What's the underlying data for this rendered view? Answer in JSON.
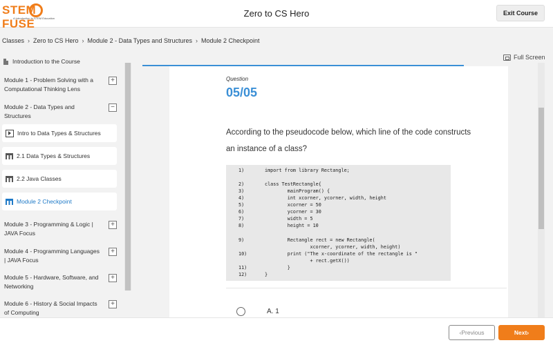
{
  "header": {
    "logo_text_left": "STEM",
    "logo_text_right": "FUSE",
    "logo_tagline": "A Introduction to STEM Education",
    "course_title": "Zero to CS Hero",
    "exit_label": "Exit Course"
  },
  "breadcrumb": [
    "Classes",
    "Zero to CS Hero",
    "Module 2 - Data Types and Structures",
    "Module 2 Checkpoint"
  ],
  "fullscreen_label": "Full Screen",
  "sidebar": {
    "intro": "Introduction to the Course",
    "modules": [
      {
        "label": "Module 1 - Problem Solving with a Computational Thinking Lens",
        "toggle": "+"
      },
      {
        "label": "Module 2 - Data Types and Structures",
        "toggle": "−"
      },
      {
        "label": "Module 3 - Programming & Logic | JAVA Focus",
        "toggle": "+"
      },
      {
        "label": "Module 4 - Programming Languages | JAVA Focus",
        "toggle": "+"
      },
      {
        "label": "Module 5 - Hardware, Software, and Networking",
        "toggle": "+"
      },
      {
        "label": "Module 6 - History & Social Impacts of Computing",
        "toggle": "+"
      }
    ],
    "lessons": [
      {
        "label": "Intro to Data Types & Structures",
        "icon": "play-icon",
        "active": false
      },
      {
        "label": "2.1 Data Types & Structures",
        "icon": "table-icon",
        "active": false
      },
      {
        "label": "2.2 Java Classes",
        "icon": "table-icon",
        "active": false
      },
      {
        "label": "Module 2 Checkpoint",
        "icon": "table-icon",
        "active": true
      }
    ]
  },
  "question": {
    "label": "Question",
    "number": "05/05",
    "text": "According to the pseudocode below, which line of the code constructs an instance of a class?",
    "code": [
      {
        "n": "1)",
        "t": "import from library Rectangle;"
      },
      {
        "n": "2)",
        "t": "class TestRectangle{"
      },
      {
        "n": "3)",
        "t": "        mainProgram() {"
      },
      {
        "n": "4)",
        "t": "        int xcorner, ycorner, width, height"
      },
      {
        "n": "5)",
        "t": "        xcorner = 50"
      },
      {
        "n": "6)",
        "t": "        ycorner = 30"
      },
      {
        "n": "7)",
        "t": "        width = 5"
      },
      {
        "n": "8)",
        "t": "        height = 10"
      },
      {
        "n": "9)",
        "t": "        Rectangle rect = new Rectangle("
      },
      {
        "n": "",
        "t": "                xcorner, ycorner, width, height)"
      },
      {
        "n": "10)",
        "t": "        print (\"The x-coordinate of the rectangle is \""
      },
      {
        "n": "",
        "t": "                + rect.getX())"
      },
      {
        "n": "11)",
        "t": "        }"
      },
      {
        "n": "12)",
        "t": "}"
      }
    ],
    "option_a": "A. 1"
  },
  "footer": {
    "prev_label": "Previous",
    "next_label": "Next"
  },
  "colors": {
    "brand": "#f07d1a",
    "accent": "#3a8fd6"
  }
}
